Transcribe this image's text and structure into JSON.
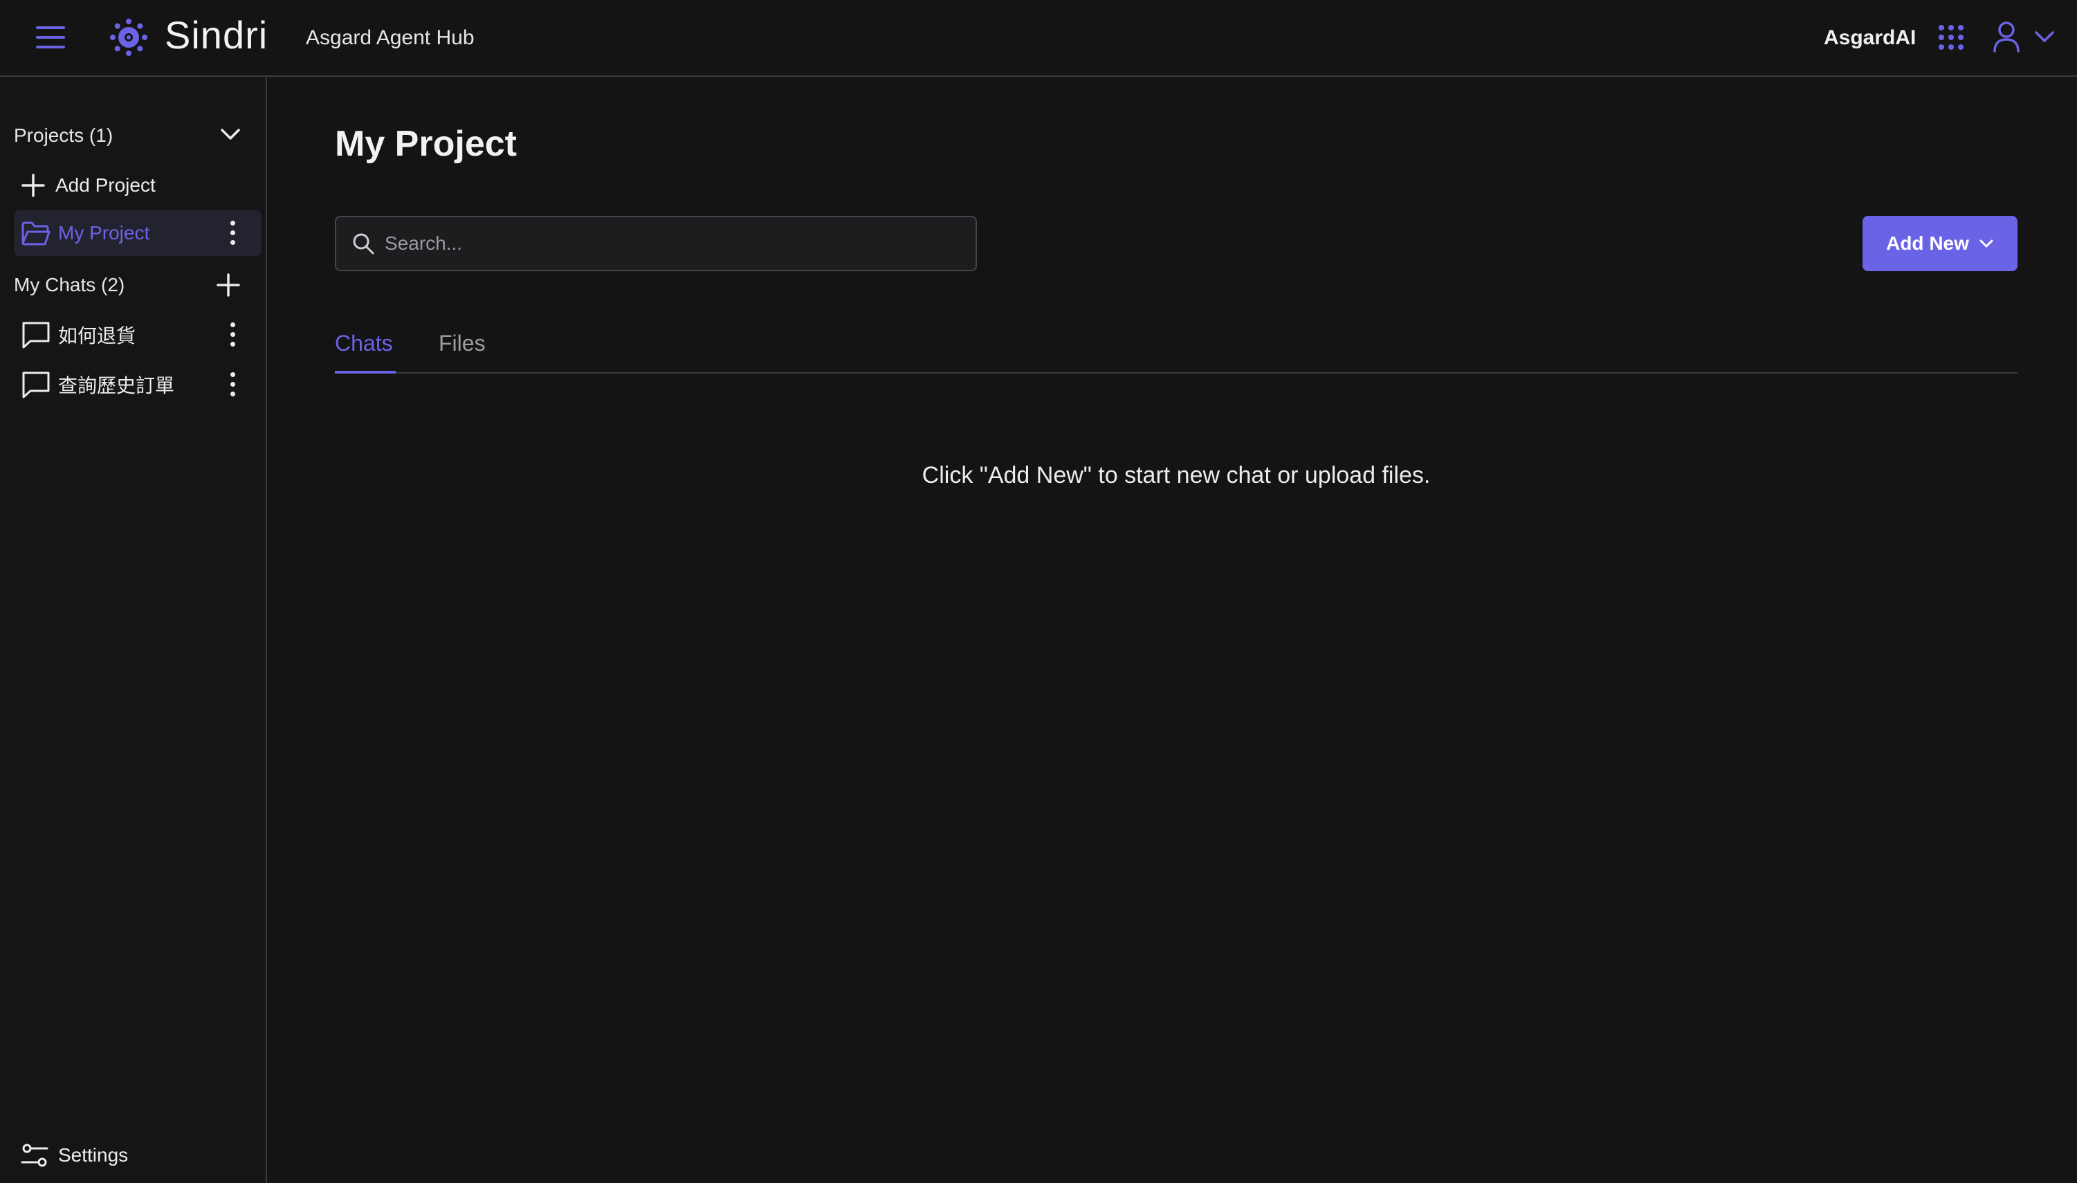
{
  "header": {
    "brand": "Sindri",
    "app_name": "Asgard Agent Hub",
    "org_name": "AsgardAI"
  },
  "sidebar": {
    "projects_label": "Projects (1)",
    "add_project_label": "Add Project",
    "projects": [
      {
        "label": "My Project",
        "selected": true
      }
    ],
    "chats_label": "My Chats (2)",
    "chats": [
      {
        "label": "如何退貨"
      },
      {
        "label": "查詢歷史訂單"
      }
    ],
    "settings_label": "Settings"
  },
  "main": {
    "title": "My Project",
    "search": {
      "placeholder": "Search..."
    },
    "add_new_label": "Add New",
    "tabs": [
      {
        "label": "Chats",
        "active": true
      },
      {
        "label": "Files",
        "active": false
      }
    ],
    "empty_message": "Click \"Add New\" to start new chat or upload files."
  },
  "colors": {
    "accent": "#6b63e6",
    "background": "#141415"
  },
  "icons": [
    "hamburger-icon",
    "sindri-logo-icon",
    "apps-grid-icon",
    "user-icon",
    "chevron-down-icon",
    "plus-icon",
    "folder-icon",
    "kebab-icon",
    "chat-icon",
    "settings-icon",
    "search-icon"
  ]
}
